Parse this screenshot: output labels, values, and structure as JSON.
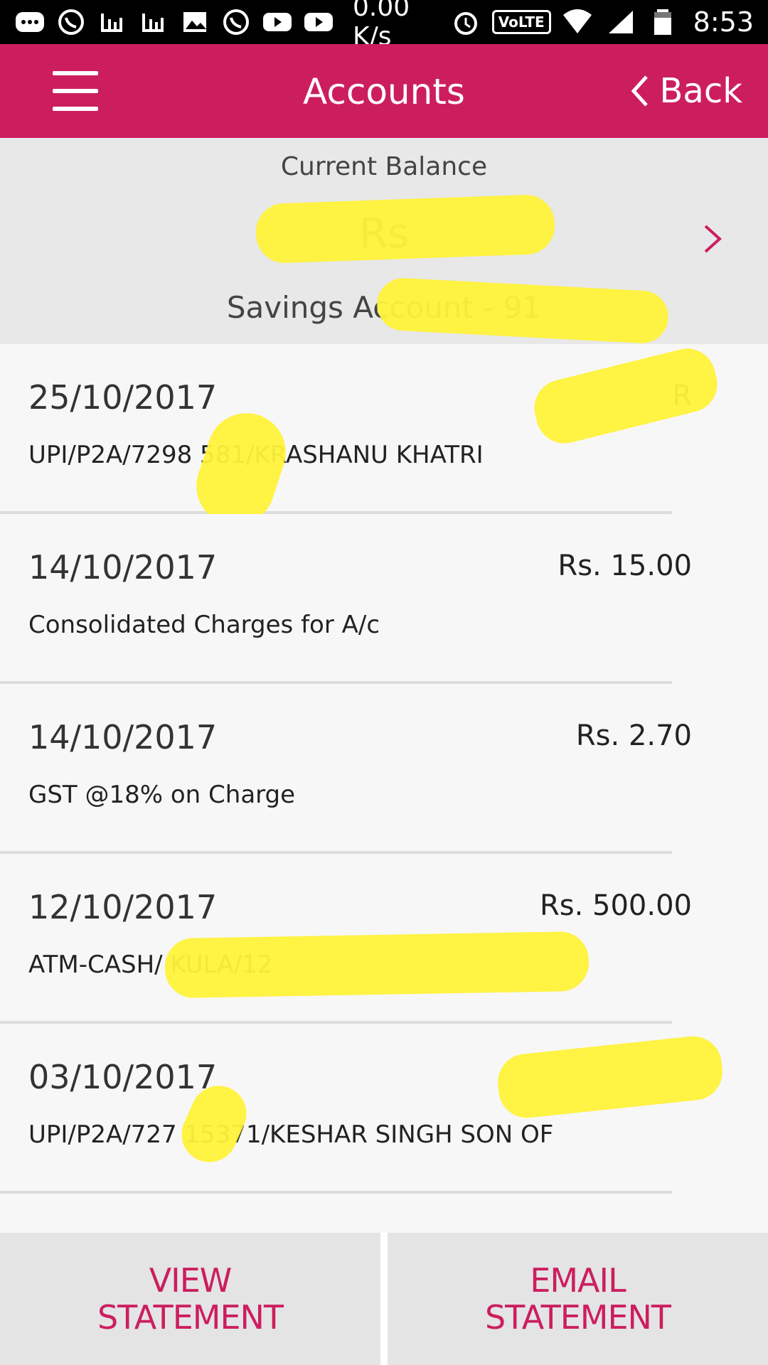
{
  "status_bar": {
    "speed": "0.00 K/s",
    "volte": "VoLTE",
    "time": "8:53",
    "icons": [
      "more-icon",
      "whatsapp-icon",
      "chart-icon",
      "chart-icon",
      "image-icon",
      "whatsapp-icon",
      "youtube-icon",
      "youtube-icon"
    ]
  },
  "app_bar": {
    "title": "Accounts",
    "back_label": "Back"
  },
  "balance": {
    "label": "Current Balance",
    "value": "Rs",
    "account_prefix": "Savings Account - 91"
  },
  "transactions": [
    {
      "date": "25/10/2017",
      "amount": "R",
      "description": "UPI/P2A/7298      581/KRASHANU KHATRI"
    },
    {
      "date": "14/10/2017",
      "amount": "Rs. 15.00",
      "description": "Consolidated Charges for A/c"
    },
    {
      "date": "14/10/2017",
      "amount": "Rs. 2.70",
      "description": "GST @18% on Charge"
    },
    {
      "date": "12/10/2017",
      "amount": "Rs. 500.00",
      "description": "ATM-CASH/                          KULA/12"
    },
    {
      "date": "03/10/2017",
      "amount": "",
      "description": "UPI/P2A/727      15371/KESHAR SINGH SON OF"
    }
  ],
  "bottom": {
    "view_line1": "VIEW",
    "view_line2": "STATEMENT",
    "email_line1": "EMAIL",
    "email_line2": "STATEMENT"
  },
  "colors": {
    "brand": "#cc1e5f",
    "redaction": "#fff23a"
  }
}
